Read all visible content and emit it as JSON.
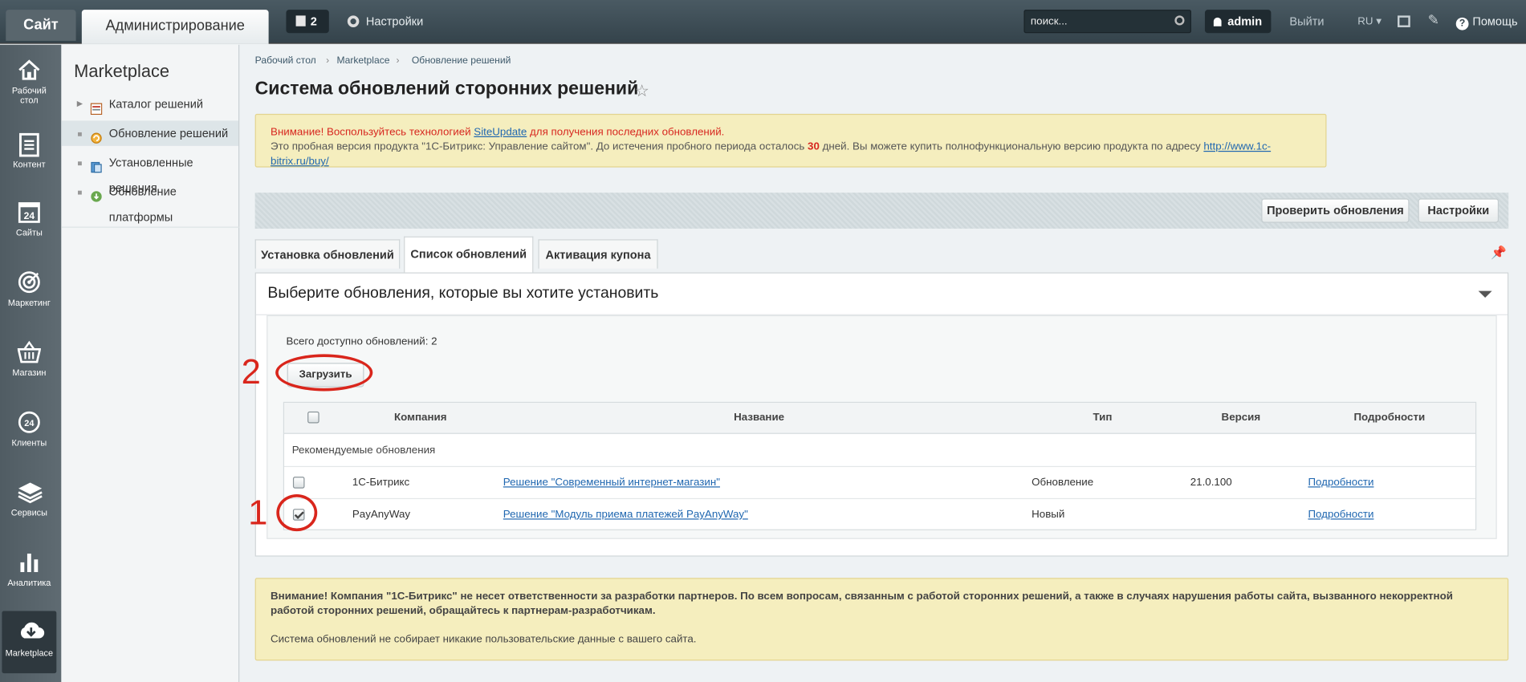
{
  "topbar": {
    "site_tab": "Сайт",
    "admin_tab": "Администрирование",
    "notifications_count": "2",
    "settings_label": "Настройки",
    "search_placeholder": "поиск...",
    "user_label": "admin",
    "logout_label": "Выйти",
    "lang_label": "RU",
    "help_label": "Помощь"
  },
  "leftbar": {
    "items": [
      {
        "label_line1": "Рабочий",
        "label_line2": "стол",
        "icon": "home-icon"
      },
      {
        "label_line1": "Контент",
        "label_line2": "",
        "icon": "document-icon"
      },
      {
        "label_line1": "Сайты",
        "label_line2": "",
        "icon": "calendar-24-icon"
      },
      {
        "label_line1": "Маркетинг",
        "label_line2": "",
        "icon": "target-icon"
      },
      {
        "label_line1": "Магазин",
        "label_line2": "",
        "icon": "basket-icon"
      },
      {
        "label_line1": "Клиенты",
        "label_line2": "",
        "icon": "clients-24-icon"
      },
      {
        "label_line1": "Сервисы",
        "label_line2": "",
        "icon": "layers-icon"
      },
      {
        "label_line1": "Аналитика",
        "label_line2": "",
        "icon": "bar-chart-icon"
      },
      {
        "label_line1": "Marketplace",
        "label_line2": "",
        "icon": "cloud-download-icon"
      }
    ]
  },
  "menu": {
    "title": "Marketplace",
    "items": [
      {
        "label": "Каталог решений",
        "marker": "▶"
      },
      {
        "label": "Обновление решений",
        "marker": ""
      },
      {
        "label": "Установленные решения",
        "marker": ""
      },
      {
        "label": "Обновление платформы",
        "marker": ""
      }
    ]
  },
  "breadcrumb": [
    "Рабочий стол",
    "Marketplace",
    "Обновление решений"
  ],
  "page_title": "Система обновлений сторонних решений",
  "warning_top": {
    "line1_prefix": "Внимание! Воспользуйтесь технологией ",
    "line1_link": "SiteUpdate",
    "line1_suffix": " для получения последних обновлений.",
    "line2_prefix": "Это пробная версия продукта \"1С-Битрикс: Управление сайтом\". До истечения пробного периода осталось ",
    "line2_days": "30",
    "line2_middle": " дней. Вы можете купить полнофункциональную версию продукта по адресу ",
    "line2_link": "http://www.1c-bitrix.ru/buy/"
  },
  "toolbar": {
    "check_updates": "Проверить обновления",
    "settings": "Настройки"
  },
  "tabs": [
    "Установка обновлений",
    "Список обновлений",
    "Активация купона"
  ],
  "panel": {
    "heading": "Выберите обновления, которые вы хотите установить",
    "total_label": "Всего доступно обновлений: 2",
    "load_button": "Загрузить"
  },
  "table": {
    "headers": [
      "Компания",
      "Название",
      "Тип",
      "Версия",
      "Подробности"
    ],
    "group_label": "Рекомендуемые обновления",
    "rows": [
      {
        "checked": false,
        "company": "1С-Битрикс",
        "name": "Решение \"Современный интернет-магазин\"",
        "type": "Обновление",
        "version": "21.0.100",
        "details": "Подробности"
      },
      {
        "checked": true,
        "company": "PayAnyWay",
        "name": "Решение \"Модуль приема платежей PayAnyWay\"",
        "type": "Новый",
        "version": "",
        "details": "Подробности"
      }
    ]
  },
  "warning_bottom": {
    "bold_text": "Внимание! Компания \"1С-Битрикс\" не несет ответственности за разработки партнеров. По всем вопросам, связанным с работой сторонних решений, а также в случаях нарушения работы сайта, вызванного некорректной работой сторонних решений, обращайтесь к партнерам-разработчикам.",
    "note": "Система обновлений не собирает никакие пользовательские данные с вашего сайта."
  },
  "annotations": {
    "first": "1",
    "second": "2",
    "color": "#d9261c"
  }
}
